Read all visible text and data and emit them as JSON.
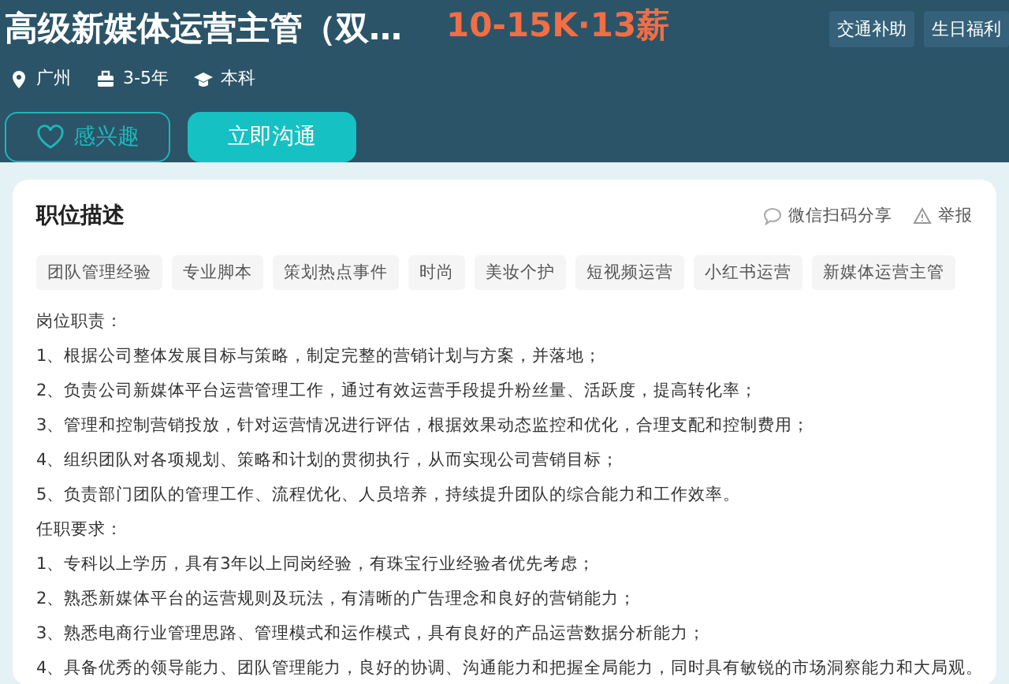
{
  "job": {
    "title": "高级新媒体运营主管（双…",
    "salary": "10-15K·13薪",
    "benefits": [
      "交通补助",
      "生日福利"
    ],
    "meta": [
      {
        "kind": "location",
        "text": "广州"
      },
      {
        "kind": "experience",
        "text": "3-5年"
      },
      {
        "kind": "education",
        "text": "本科"
      }
    ],
    "buttons": [
      {
        "kind": "interest",
        "label": "感兴趣"
      },
      {
        "kind": "chat",
        "label": "立即沟通"
      }
    ]
  },
  "description": {
    "heading": "职位描述",
    "actions": [
      {
        "kind": "share",
        "label": "微信扫码分享"
      },
      {
        "kind": "report",
        "label": "举报"
      }
    ],
    "tags": [
      "团队管理经验",
      "专业脚本",
      "策划热点事件",
      "时尚",
      "美妆个护",
      "短视频运营",
      "小红书运营",
      "新媒体运营主管"
    ],
    "lines": [
      "岗位职责：",
      "1、根据公司整体发展目标与策略，制定完整的营销计划与方案，并落地；",
      "2、负责公司新媒体平台运营管理工作，通过有效运营手段提升粉丝量、活跃度，提高转化率；",
      "3、管理和控制营销投放，针对运营情况进行评估，根据效果动态监控和优化，合理支配和控制费用；",
      "4、组织团队对各项规划、策略和计划的贯彻执行，从而实现公司营销目标；",
      "5、负责部门团队的管理工作、流程优化、人员培养，持续提升团队的综合能力和工作效率。",
      "任职要求：",
      "1、专科以上学历，具有3年以上同岗经验，有珠宝行业经验者优先考虑；",
      "2、熟悉新媒体平台的运营规则及玩法，有清晰的广告理念和良好的营销能力；",
      "3、熟悉电商行业管理思路、管理模式和运作模式，具有良好的产品运营数据分析能力；",
      "4、具备优秀的领导能力、团队管理能力，良好的协调、沟通能力和把握全局能力，同时具有敏锐的市场洞察能力和大局观。"
    ]
  }
}
